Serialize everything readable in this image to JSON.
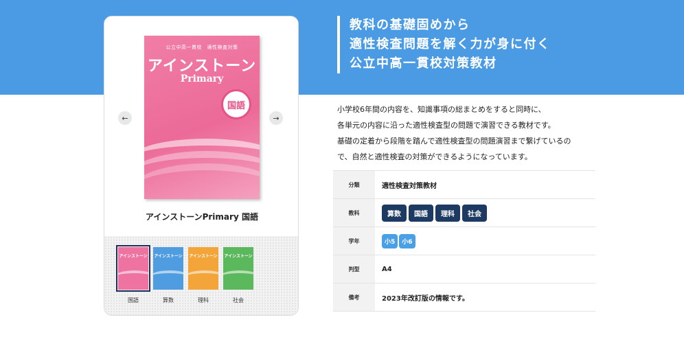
{
  "headline": {
    "lines": [
      "教科の基礎固めから",
      "適性検査問題を解く力が身に付く",
      "公立中高一貫校対策教材"
    ]
  },
  "description": [
    "小学校6年間の内容を、知識事項の総まとめをすると同時に、",
    "各単元の内容に沿った適性検査型の問題で演習できる教材です。",
    "基礎の定着から段階を踏んで適性検査型の問題演習まで繋げているの",
    "で、自然と適性検査の対策ができるようになっています。"
  ],
  "book": {
    "series": "公立中高一貫校　適性検査対策",
    "title": "アインストーン",
    "subtitle": "Primary",
    "subject_badge": "国語",
    "name": "アインストーンPrimary 国語",
    "prev_icon": "arrow-left-icon",
    "next_icon": "arrow-right-icon"
  },
  "thumbnails": [
    {
      "label": "国語",
      "cover_title": "アインストーン",
      "color": "#ee73a0",
      "active": true
    },
    {
      "label": "算数",
      "cover_title": "アインストーン",
      "color": "#4f9de0",
      "active": false
    },
    {
      "label": "理科",
      "cover_title": "アインストーン",
      "color": "#f3a53a",
      "active": false
    },
    {
      "label": "社会",
      "cover_title": "アインストーン",
      "color": "#5cb85c",
      "active": false
    }
  ],
  "spec": {
    "category_label": "分類",
    "category_value": "適性検査対策教材",
    "subject_label": "教科",
    "subjects": [
      "算数",
      "国語",
      "理科",
      "社会"
    ],
    "grade_label": "学年",
    "grades": [
      "小5",
      "小6"
    ],
    "size_label": "判型",
    "size_value": "A4",
    "note_label": "備考",
    "note_value": "2023年改訂版の情報です。"
  },
  "colors": {
    "hero_band": "#4a9be4",
    "tag_dark": "#1c3a62",
    "tag_light": "#4aa0e6"
  }
}
